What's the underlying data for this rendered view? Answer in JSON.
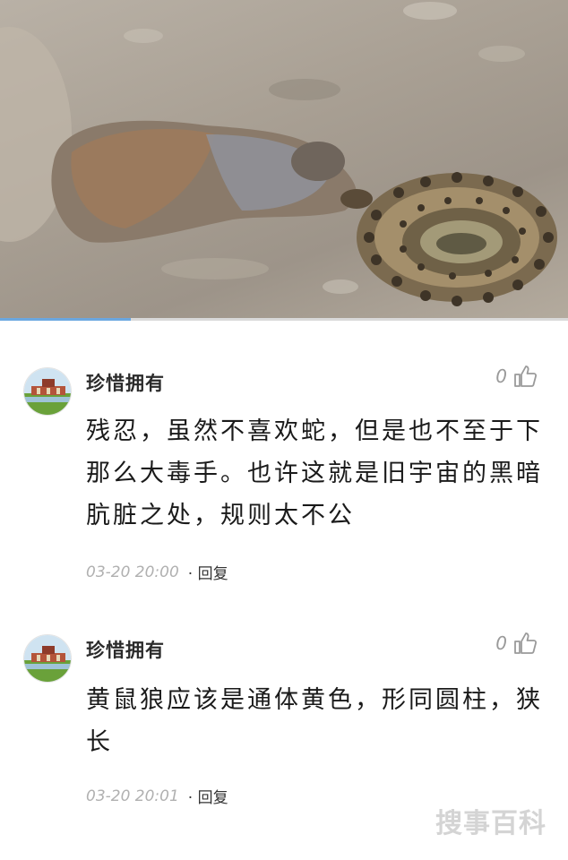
{
  "media": {
    "description_icon": "video-frame",
    "progress_fraction": 0.23
  },
  "comments": [
    {
      "username": "珍惜拥有",
      "likes": "0",
      "text": "残忍，虽然不喜欢蛇，但是也不至于下那么大毒手。也许这就是旧宇宙的黑暗肮脏之处，规则太不公",
      "time": "03-20  20:00",
      "reply_label": "· 回复"
    },
    {
      "username": "珍惜拥有",
      "likes": "0",
      "text": "黄鼠狼应该是通体黄色，形同圆柱，狭长",
      "time": "03-20  20:01",
      "reply_label": "· 回复"
    }
  ],
  "watermark": "搜事百科",
  "colors": {
    "progress": "#6aa7e0",
    "text": "#1a1a1a",
    "meta": "#b0b0b0"
  }
}
